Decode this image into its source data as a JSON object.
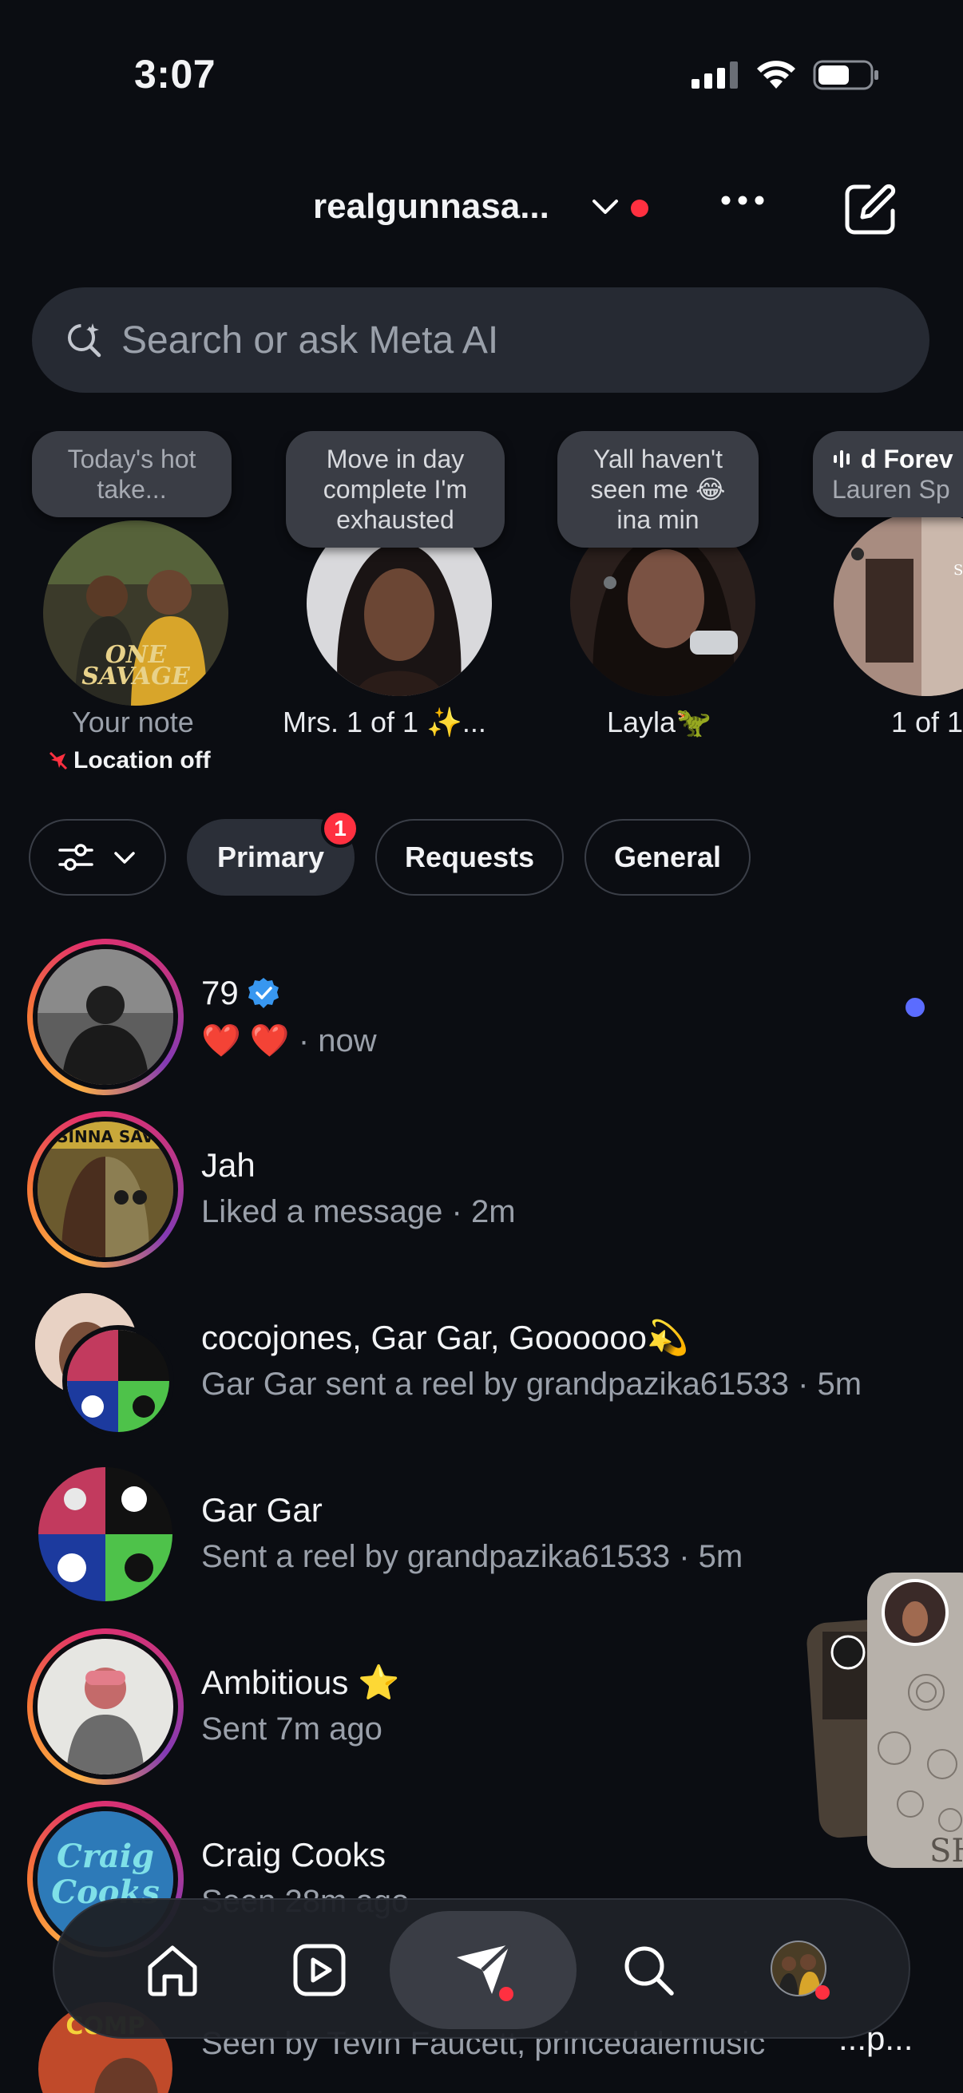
{
  "status": {
    "time": "3:07"
  },
  "header": {
    "account": "realgunnasa...",
    "chevron_icon": "chevron-down-icon",
    "more_icon": "more-horizontal-icon",
    "compose_icon": "compose-icon"
  },
  "search": {
    "placeholder": "Search or ask Meta AI",
    "icon": "meta-ai-search-icon"
  },
  "notes": [
    {
      "bubble": "Today's hot take...",
      "name": "Your note",
      "sub": "Location off"
    },
    {
      "bubble": "Move in day complete I'm exhausted",
      "name": "Mrs. 1 of 1 ✨..."
    },
    {
      "bubble": "Yall haven't seen me 😂 ina min",
      "name": "Layla🦖"
    },
    {
      "bubble_title": "d Forev",
      "bubble_sub": "Lauren Sp",
      "name": "1 of 1"
    }
  ],
  "filters": {
    "primary": "Primary",
    "primary_badge": "1",
    "requests": "Requests",
    "general": "General"
  },
  "threads": [
    {
      "name": "79",
      "sub": "❤️ ❤️ · now",
      "verified": true,
      "unread": true
    },
    {
      "name": "Jah",
      "sub": "Liked a message · 2m"
    },
    {
      "name": "cocojones, Gar Gar, Goooooo💫",
      "sub": "Gar Gar sent a reel by grandpazika61533 · 5m"
    },
    {
      "name": "Gar Gar",
      "sub": "Sent a reel by grandpazika61533 · 5m"
    },
    {
      "name": "Ambitious ⭐",
      "sub": "Sent 7m ago"
    },
    {
      "name": "Craig Cooks",
      "sub": "Seen 28m ago"
    },
    {
      "name": "",
      "sub": "Seen by Tevin Faucett, princedalemusic",
      "right_fragment": "...p..."
    }
  ],
  "nav": {
    "items": [
      "home-icon",
      "reels-icon",
      "direct-icon",
      "search-icon",
      "profile-avatar"
    ]
  },
  "colors": {
    "background": "#0b0d12",
    "unread": "#5b6cff",
    "notification": "#ff3040",
    "verified": "#3897f0"
  }
}
